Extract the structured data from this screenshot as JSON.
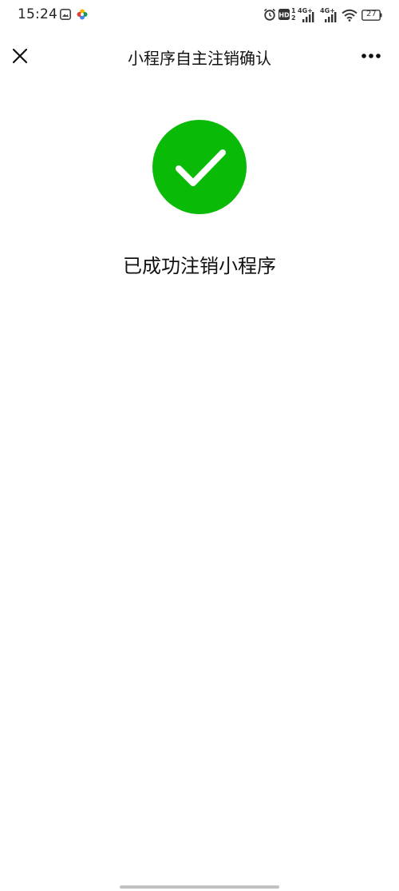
{
  "status_bar": {
    "time": "15:24",
    "hd_sub": "1",
    "hd_sub2": "2",
    "network1": "4G+",
    "network2": "4G+",
    "battery": "27",
    "icons": [
      "gallery-icon",
      "colorful-app-icon",
      "alarm-icon",
      "hd-icon",
      "signal-icon",
      "signal-icon",
      "wifi-icon",
      "battery-icon"
    ]
  },
  "nav": {
    "title": "小程序自主注销确认",
    "close_icon": "close-icon",
    "more_icon": "more-icon"
  },
  "result": {
    "icon": "success-check-icon",
    "message": "已成功注销小程序",
    "color": "#09BB07"
  }
}
